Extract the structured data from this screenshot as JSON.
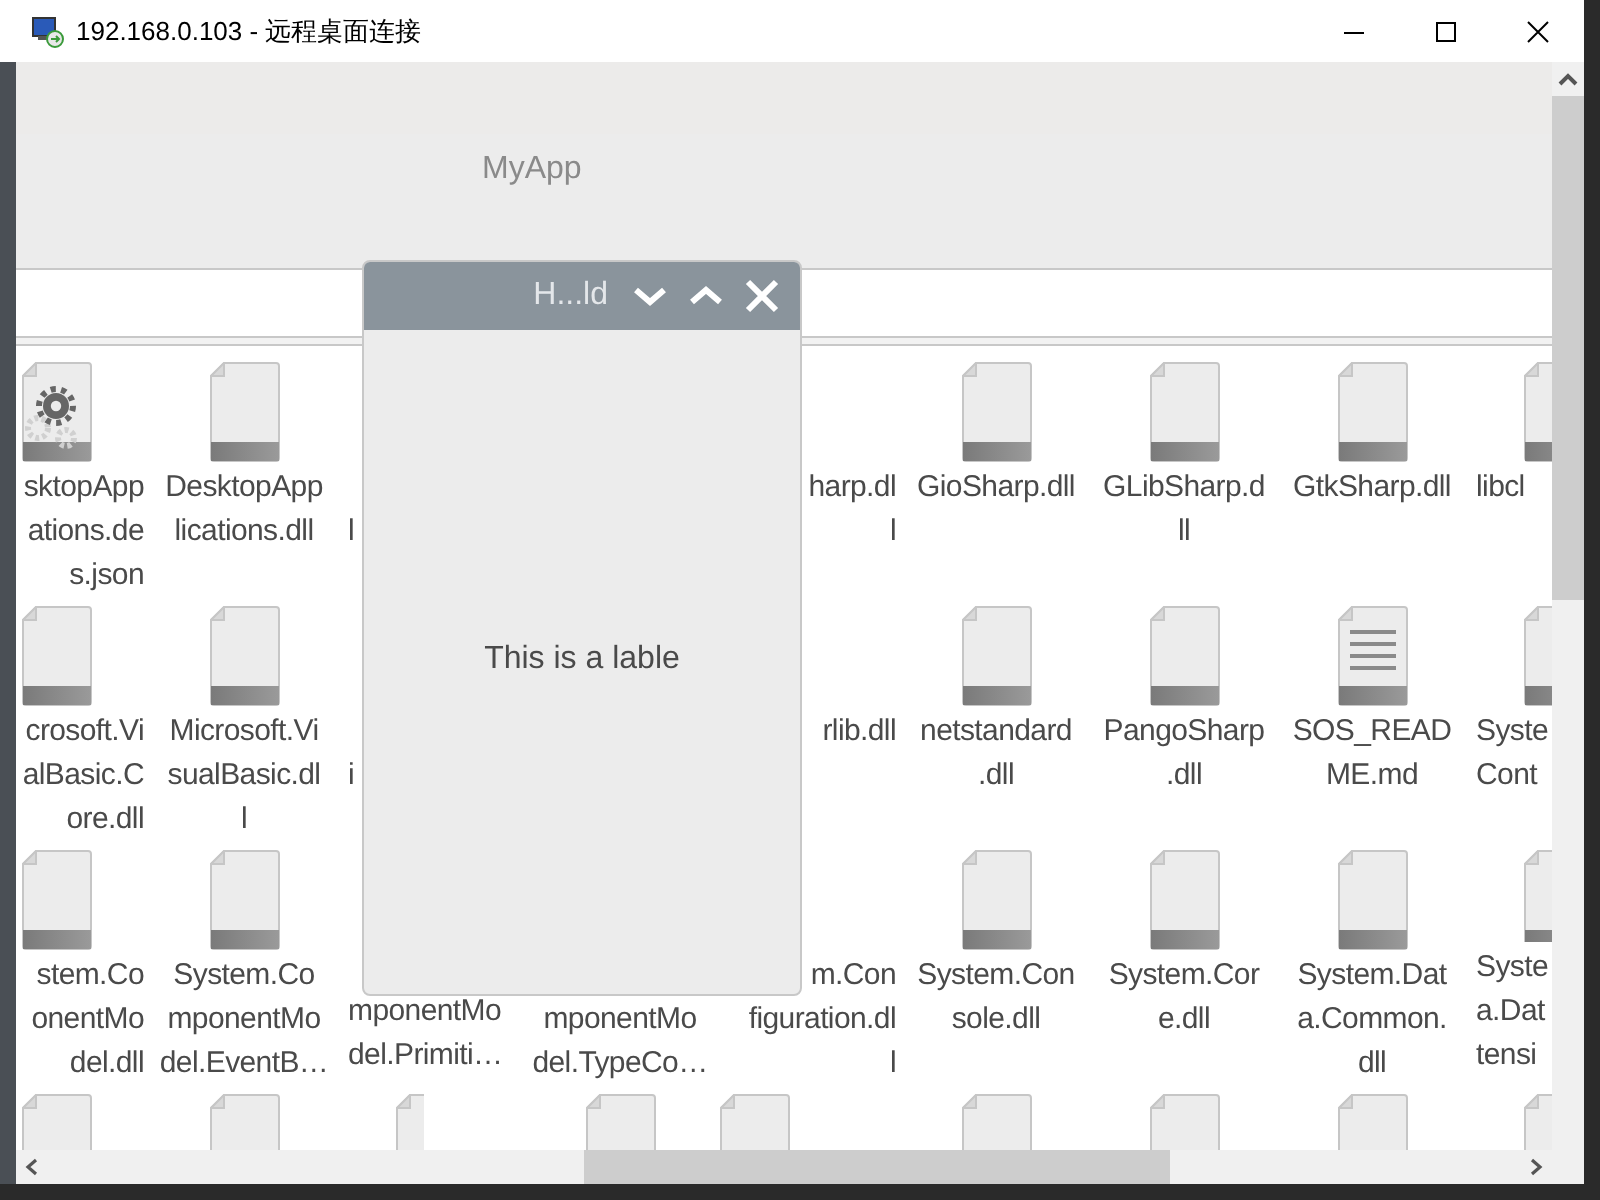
{
  "window": {
    "title": "192.168.0.103 - 远程桌面连接"
  },
  "app": {
    "title": "MyApp"
  },
  "files": {
    "columns": [
      {
        "kind": "cut_left",
        "items": [
          {
            "kind": "settings_file",
            "lines": [
              "sktopApp",
              "ations.de",
              "s.json"
            ]
          },
          {
            "kind": "file",
            "lines": [
              "crosoft.Vi",
              "alBasic.C",
              "ore.dll"
            ]
          },
          {
            "kind": "file",
            "lines": [
              "stem.Co",
              "onentMo",
              "del.dll"
            ]
          },
          {
            "kind": "file"
          }
        ]
      },
      {
        "kind": "whole",
        "items": [
          {
            "kind": "file",
            "lines": [
              "DesktopApp",
              "lications.dll"
            ]
          },
          {
            "kind": "file",
            "lines": [
              "Microsoft.Vi",
              "sualBasic.dl",
              "l"
            ]
          },
          {
            "kind": "file",
            "lines": [
              "System.Co",
              "mponentMo",
              "del.EventB…"
            ]
          },
          {
            "kind": "file"
          }
        ]
      },
      {
        "kind": "cut_right",
        "items": [
          {
            "kind": "hidden",
            "lines": [
              "l"
            ]
          },
          {
            "kind": "hidden",
            "lines": [
              "i"
            ]
          },
          {
            "kind": "hidden",
            "lines": [
              "mponentMo",
              "del.Primiti…"
            ]
          },
          {
            "kind": "file"
          }
        ]
      },
      {
        "kind": "whole",
        "items": [
          {
            "kind": "hidden"
          },
          {
            "kind": "hidden"
          },
          {
            "kind": "hidden",
            "lines": [
              "mponentMo",
              "del.TypeCo…"
            ]
          },
          {
            "kind": "file"
          }
        ]
      },
      {
        "kind": "cut_left",
        "items": [
          {
            "kind": "file",
            "lines": [
              "harp.dl",
              "l"
            ]
          },
          {
            "kind": "file",
            "lines": [
              "rlib.dll"
            ]
          },
          {
            "kind": "file",
            "lines": [
              "m.Con",
              "figuration.dl",
              "l"
            ]
          },
          {
            "kind": "file"
          }
        ]
      },
      {
        "kind": "whole",
        "items": [
          {
            "kind": "file",
            "lines": [
              "GioSharp.dll"
            ]
          },
          {
            "kind": "file",
            "lines": [
              "netstandard",
              ".dll"
            ]
          },
          {
            "kind": "file",
            "lines": [
              "System.Con",
              "sole.dll"
            ]
          },
          {
            "kind": "file"
          }
        ]
      },
      {
        "kind": "whole",
        "items": [
          {
            "kind": "file",
            "lines": [
              "GLibSharp.d",
              "ll"
            ]
          },
          {
            "kind": "file",
            "lines": [
              "PangoSharp",
              ".dll"
            ]
          },
          {
            "kind": "file",
            "lines": [
              "System.Cor",
              "e.dll"
            ]
          },
          {
            "kind": "file"
          }
        ]
      },
      {
        "kind": "whole",
        "items": [
          {
            "kind": "file",
            "lines": [
              "GtkSharp.dll"
            ]
          },
          {
            "kind": "text_file",
            "lines": [
              "SOS_READ",
              "ME.md"
            ]
          },
          {
            "kind": "file",
            "lines": [
              "System.Dat",
              "a.Common.",
              "dll"
            ]
          },
          {
            "kind": "file"
          }
        ]
      },
      {
        "kind": "cut_right",
        "items": [
          {
            "kind": "file",
            "lines": [
              "libcl"
            ]
          },
          {
            "kind": "file",
            "lines": [
              "Syste",
              "Cont"
            ]
          },
          {
            "kind": "file",
            "lines": [
              "Syste",
              "a.Dat",
              "tensi"
            ]
          },
          {
            "kind": "file"
          }
        ]
      }
    ]
  },
  "dialog": {
    "title": "H...ld",
    "label": "This is a lable"
  }
}
